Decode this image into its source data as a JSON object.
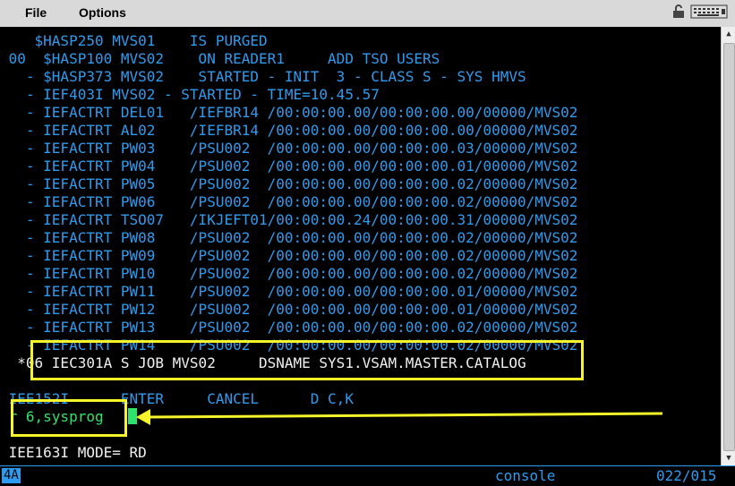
{
  "menubar": {
    "file": "File",
    "options": "Options"
  },
  "console_lines": [
    "    $HASP250 MVS01    IS PURGED",
    " 00  $HASP100 MVS02    ON READER1     ADD TSO USERS",
    "   - $HASP373 MVS02    STARTED - INIT  3 - CLASS S - SYS HMVS",
    "   - IEF403I MVS02 - STARTED - TIME=10.45.57",
    "   - IEFACTRT DEL01   /IEFBR14 /00:00:00.00/00:00:00.00/00000/MVS02",
    "   - IEFACTRT AL02    /IEFBR14 /00:00:00.00/00:00:00.00/00000/MVS02",
    "   - IEFACTRT PW03    /PSU002  /00:00:00.00/00:00:00.03/00000/MVS02",
    "   - IEFACTRT PW04    /PSU002  /00:00:00.00/00:00:00.01/00000/MVS02",
    "   - IEFACTRT PW05    /PSU002  /00:00:00.00/00:00:00.02/00000/MVS02",
    "   - IEFACTRT PW06    /PSU002  /00:00:00.00/00:00:00.02/00000/MVS02",
    "   - IEFACTRT TSO07   /IKJEFT01/00:00:00.24/00:00:00.31/00000/MVS02",
    "   - IEFACTRT PW08    /PSU002  /00:00:00.00/00:00:00.02/00000/MVS02",
    "   - IEFACTRT PW09    /PSU002  /00:00:00.00/00:00:00.02/00000/MVS02",
    "   - IEFACTRT PW10    /PSU002  /00:00:00.00/00:00:00.02/00000/MVS02",
    "   - IEFACTRT PW11    /PSU002  /00:00:00.00/00:00:00.01/00000/MVS02",
    "   - IEFACTRT PW12    /PSU002  /00:00:00.00/00:00:00.01/00000/MVS02",
    "   - IEFACTRT PW13    /PSU002  /00:00:00.00/00:00:00.02/00000/MVS02",
    "   - IEFACTRT PW14    /PSU002  /00:00:00.00/00:00:00.02/00000/MVS02"
  ],
  "reply_request": "  *06 IEC301A S JOB MVS02     DSNAME SYS1.VSAM.MASTER.CATALOG",
  "pfk_line": " IEE152I      ENTER     CANCEL      D C,K",
  "command_input": " r 6,sysprog",
  "mode_line": " IEE163I MODE= RD",
  "status": {
    "oia": "4A",
    "session": "console",
    "cursor_pos": "022/015"
  },
  "colors": {
    "text_blue": "#2d9cf0",
    "text_white": "#f0f0f0",
    "input_green": "#2ee36a",
    "annotation_yellow": "#f5f52a"
  },
  "icons": [
    "lock-icon",
    "keyboard-icon"
  ]
}
